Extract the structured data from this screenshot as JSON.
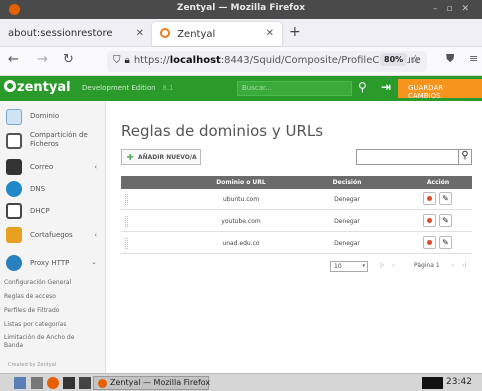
{
  "window": {
    "title": "Zentyal — Mozilla Firefox"
  },
  "tabs": [
    {
      "label": "about:sessionrestore"
    },
    {
      "label": "Zentyal"
    }
  ],
  "nav": {
    "url_prefix": "https://",
    "url_host": "localhost",
    "url_rest": ":8443/Squid/Composite/ProfileConfigure",
    "zoom": "80%"
  },
  "header": {
    "logo": "zentyal",
    "edition": "Development Edition",
    "version": "8.1",
    "search_placeholder": "Buscar...",
    "save_label": "GUARDAR CAMBIOS",
    "brand_color": "#2a9a2a",
    "accent_color": "#f7941d"
  },
  "sidebar": {
    "items": [
      {
        "label": "Dominio",
        "icon": "domain-icon"
      },
      {
        "label": "Compartición de Ficheros",
        "icon": "file-sharing-icon"
      },
      {
        "label": "Correo",
        "icon": "mail-icon",
        "arrow": "‹"
      },
      {
        "label": "DNS",
        "icon": "dns-icon"
      },
      {
        "label": "DHCP",
        "icon": "dhcp-icon"
      },
      {
        "label": "Cortafuegos",
        "icon": "firewall-icon",
        "arrow": "‹"
      },
      {
        "label": "Proxy HTTP",
        "icon": "proxy-icon",
        "arrow": "⌄"
      }
    ],
    "subitems": [
      "Configuración General",
      "Reglas de acceso",
      "Perfiles de Filtrado",
      "Listas por categorías",
      "Limitación de Ancho de Banda"
    ],
    "footer": "Created by Zentyal"
  },
  "main": {
    "title": "Reglas de dominios y URLs",
    "add_button": "AÑADIR NUEVO/A",
    "columns": [
      "Dominio o URL",
      "Decisión",
      "Acción"
    ],
    "rows": [
      {
        "url": "ubuntu.com",
        "decision": "Denegar"
      },
      {
        "url": "youtube.com",
        "decision": "Denegar"
      },
      {
        "url": "unad.edu.co",
        "decision": "Denegar"
      }
    ],
    "pager": {
      "page_size": "10",
      "page_label": "Página 1"
    }
  },
  "taskbar": {
    "app_label": "Zentyal — Mozilla Firefox",
    "clock": "23:42"
  }
}
